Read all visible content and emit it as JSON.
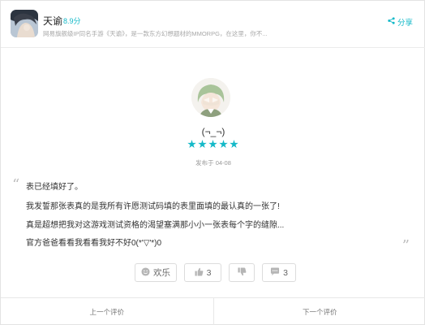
{
  "header": {
    "app_name": "天谕",
    "score": "8.9分",
    "description": "网易旗舰级IP同名手游《天谕》，是一款东方幻想题材的MMORPG，在这里，你不...",
    "share_label": "分享"
  },
  "review": {
    "user_name": "(¬_¬)",
    "rating": 5,
    "date": "发布于 04-08",
    "quote_open": "“",
    "quote_close": "”",
    "lines": [
      "表已经填好了。",
      "我发誓那张表真的是我所有许愿测试码填的表里面填的最认真的一张了!",
      "真是超想把我对这游戏测试资格的渴望塞满那小小一张表每个字的缝隙...",
      "官方爸爸看看我看看我好不好0(*'▽'*)0"
    ]
  },
  "actions": {
    "fun_label": "欢乐",
    "up_count": "3",
    "reply_count": "3"
  },
  "footer": {
    "prev_label": "上一个评价",
    "next_label": "下一个评价"
  },
  "colors": {
    "accent": "#14b9c8",
    "text": "#333333",
    "muted": "#999999",
    "border": "#dcdcdc"
  },
  "icons": [
    "app-icon",
    "share-icon",
    "star-icon",
    "smile-icon",
    "thumbs-up-icon",
    "thumbs-down-icon",
    "comment-icon"
  ]
}
